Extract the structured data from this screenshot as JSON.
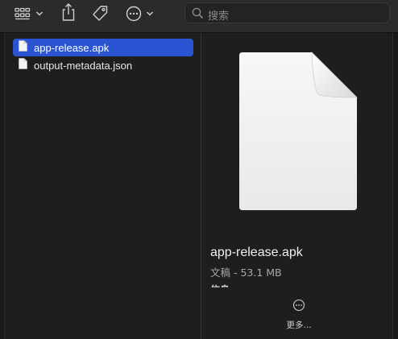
{
  "toolbar": {
    "view_icon": "grid-view-icon",
    "share_icon": "share-icon",
    "tag_icon": "tag-icon",
    "action_icon": "ellipsis-circle-icon",
    "search": {
      "placeholder": "搜索",
      "icon": "search-icon"
    }
  },
  "files": [
    {
      "name": "app-release.apk",
      "selected": true,
      "icon": "document-icon"
    },
    {
      "name": "output-metadata.json",
      "selected": false,
      "icon": "document-icon"
    }
  ],
  "preview": {
    "icon": "document-large-icon",
    "name": "app-release.apk",
    "meta": "文稿 - 53.1 MB",
    "cut_text": "信息",
    "more_label": "更多...",
    "more_icon": "ellipsis-circle-icon"
  },
  "colors": {
    "selection": "#2a54d1",
    "background": "#1e1e1e",
    "toolbar": "#2b2b2b"
  }
}
